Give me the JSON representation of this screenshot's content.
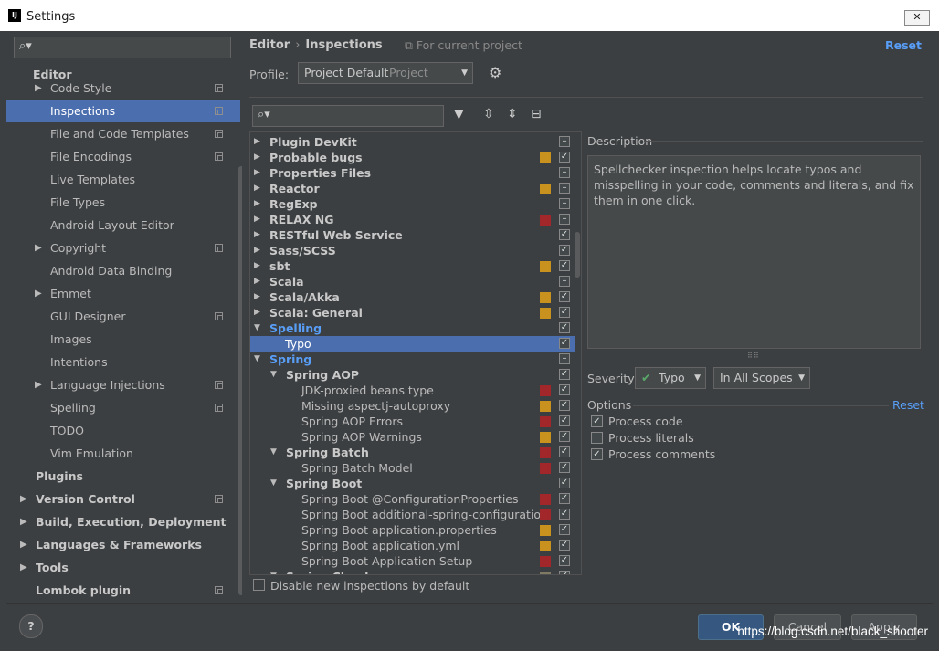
{
  "window": {
    "title": "Settings",
    "app_icon": "IJ",
    "close": "✕"
  },
  "left": {
    "search_placeholder": "",
    "items": [
      {
        "label": "Editor",
        "bold": true,
        "indent": 0,
        "arrow": "",
        "copy": false,
        "top": 0
      },
      {
        "label": "Code Style",
        "arrow": "▶",
        "copy": true
      },
      {
        "label": "Inspections",
        "selected": true,
        "copy": true
      },
      {
        "label": "File and Code Templates",
        "copy": true
      },
      {
        "label": "File Encodings",
        "copy": true
      },
      {
        "label": "Live Templates"
      },
      {
        "label": "File Types"
      },
      {
        "label": "Android Layout Editor"
      },
      {
        "label": "Copyright",
        "arrow": "▶",
        "copy": true
      },
      {
        "label": "Android Data Binding"
      },
      {
        "label": "Emmet",
        "arrow": "▶"
      },
      {
        "label": "GUI Designer",
        "copy": true
      },
      {
        "label": "Images"
      },
      {
        "label": "Intentions"
      },
      {
        "label": "Language Injections",
        "arrow": "▶",
        "copy": true
      },
      {
        "label": "Spelling",
        "copy": true
      },
      {
        "label": "TODO"
      },
      {
        "label": "Vim Emulation"
      },
      {
        "label": "Plugins",
        "bold": true
      },
      {
        "label": "Version Control",
        "bold": true,
        "arrow": "▶",
        "copy": true
      },
      {
        "label": "Build, Execution, Deployment",
        "bold": true,
        "arrow": "▶"
      },
      {
        "label": "Languages & Frameworks",
        "bold": true,
        "arrow": "▶"
      },
      {
        "label": "Tools",
        "bold": true,
        "arrow": "▶"
      },
      {
        "label": "Lombok plugin",
        "bold": true,
        "copy": true
      }
    ]
  },
  "header": {
    "crumb_editor": "Editor",
    "crumb_sep": "›",
    "crumb_page": "Inspections",
    "for_project": "For current project",
    "reset": "Reset"
  },
  "profile": {
    "label": "Profile:",
    "value": "Project Default",
    "scope": "Project"
  },
  "colors": {
    "error": "#a1272a",
    "warning": "#c9921f",
    "weak": "#807a64",
    "accent": "#589df6",
    "selection": "#4b6eaf"
  },
  "inspections": {
    "rows": [
      {
        "label": "Plugin DevKit",
        "level": 0,
        "arrow": "▶",
        "sev": "",
        "check": "minus"
      },
      {
        "label": "Probable bugs",
        "level": 0,
        "arrow": "▶",
        "sev": "warning",
        "check": "on"
      },
      {
        "label": "Properties Files",
        "level": 0,
        "arrow": "▶",
        "sev": "",
        "check": "minus"
      },
      {
        "label": "Reactor",
        "level": 0,
        "arrow": "▶",
        "sev": "warning",
        "check": "minus"
      },
      {
        "label": "RegExp",
        "level": 0,
        "arrow": "▶",
        "sev": "",
        "check": "minus"
      },
      {
        "label": "RELAX NG",
        "level": 0,
        "arrow": "▶",
        "sev": "error",
        "check": "minus"
      },
      {
        "label": "RESTful Web Service",
        "level": 0,
        "arrow": "▶",
        "sev": "",
        "check": "on"
      },
      {
        "label": "Sass/SCSS",
        "level": 0,
        "arrow": "▶",
        "sev": "",
        "check": "on"
      },
      {
        "label": "sbt",
        "level": 0,
        "arrow": "▶",
        "sev": "warning",
        "check": "on"
      },
      {
        "label": "Scala",
        "level": 0,
        "arrow": "▶",
        "sev": "",
        "check": "minus"
      },
      {
        "label": "Scala/Akka",
        "level": 0,
        "arrow": "▶",
        "sev": "warning",
        "check": "on"
      },
      {
        "label": "Scala: General",
        "level": 0,
        "arrow": "▶",
        "sev": "warning",
        "check": "on"
      },
      {
        "label": "Spelling",
        "level": 0,
        "arrow": "▼",
        "sev": "",
        "check": "on",
        "blue": true
      },
      {
        "label": "Typo",
        "level": 1,
        "arrow": "",
        "sev": "",
        "check": "on",
        "selected": true,
        "leaf": true
      },
      {
        "label": "Spring",
        "level": 0,
        "arrow": "▼",
        "sev": "",
        "check": "minus",
        "blue": true
      },
      {
        "label": "Spring AOP",
        "level": 1,
        "arrow": "▼",
        "sev": "",
        "check": "on"
      },
      {
        "label": "JDK-proxied beans type",
        "level": 2,
        "arrow": "",
        "sev": "error",
        "check": "on",
        "leaf": true
      },
      {
        "label": "Missing aspectj-autoproxy",
        "level": 2,
        "arrow": "",
        "sev": "warning",
        "check": "on",
        "leaf": true
      },
      {
        "label": "Spring AOP Errors",
        "level": 2,
        "arrow": "",
        "sev": "error",
        "check": "on",
        "leaf": true
      },
      {
        "label": "Spring AOP Warnings",
        "level": 2,
        "arrow": "",
        "sev": "warning",
        "check": "on",
        "leaf": true
      },
      {
        "label": "Spring Batch",
        "level": 1,
        "arrow": "▼",
        "sev": "error",
        "check": "on"
      },
      {
        "label": "Spring Batch Model",
        "level": 2,
        "arrow": "",
        "sev": "error",
        "check": "on",
        "leaf": true
      },
      {
        "label": "Spring Boot",
        "level": 1,
        "arrow": "▼",
        "sev": "",
        "check": "on"
      },
      {
        "label": "Spring Boot @ConfigurationProperties",
        "level": 2,
        "arrow": "",
        "sev": "error",
        "check": "on",
        "leaf": true
      },
      {
        "label": "Spring Boot additional-spring-configuration",
        "level": 2,
        "arrow": "",
        "sev": "error",
        "check": "on",
        "leaf": true
      },
      {
        "label": "Spring Boot application.properties",
        "level": 2,
        "arrow": "",
        "sev": "warning",
        "check": "on",
        "leaf": true
      },
      {
        "label": "Spring Boot application.yml",
        "level": 2,
        "arrow": "",
        "sev": "warning",
        "check": "on",
        "leaf": true
      },
      {
        "label": "Spring Boot Application Setup",
        "level": 2,
        "arrow": "",
        "sev": "error",
        "check": "on",
        "leaf": true
      },
      {
        "label": "Spring Cloud",
        "level": 1,
        "arrow": "▼",
        "sev": "weak",
        "check": "on"
      }
    ]
  },
  "disable_new": "Disable new inspections by default",
  "description": {
    "title": "Description",
    "text": "Spellchecker inspection helps locate typos and misspelling in your code, comments and literals, and fix them in one click."
  },
  "severity": {
    "label": "Severity:",
    "value": "Typo",
    "scope": "In All Scopes"
  },
  "options": {
    "title": "Options",
    "reset": "Reset",
    "items": [
      {
        "label": "Process code",
        "checked": true
      },
      {
        "label": "Process literals",
        "checked": false
      },
      {
        "label": "Process comments",
        "checked": true
      }
    ]
  },
  "buttons": {
    "help": "?",
    "ok": "OK",
    "cancel": "Cancel",
    "apply": "Apply"
  },
  "watermark": "https://blog.csdn.net/black_shooter"
}
